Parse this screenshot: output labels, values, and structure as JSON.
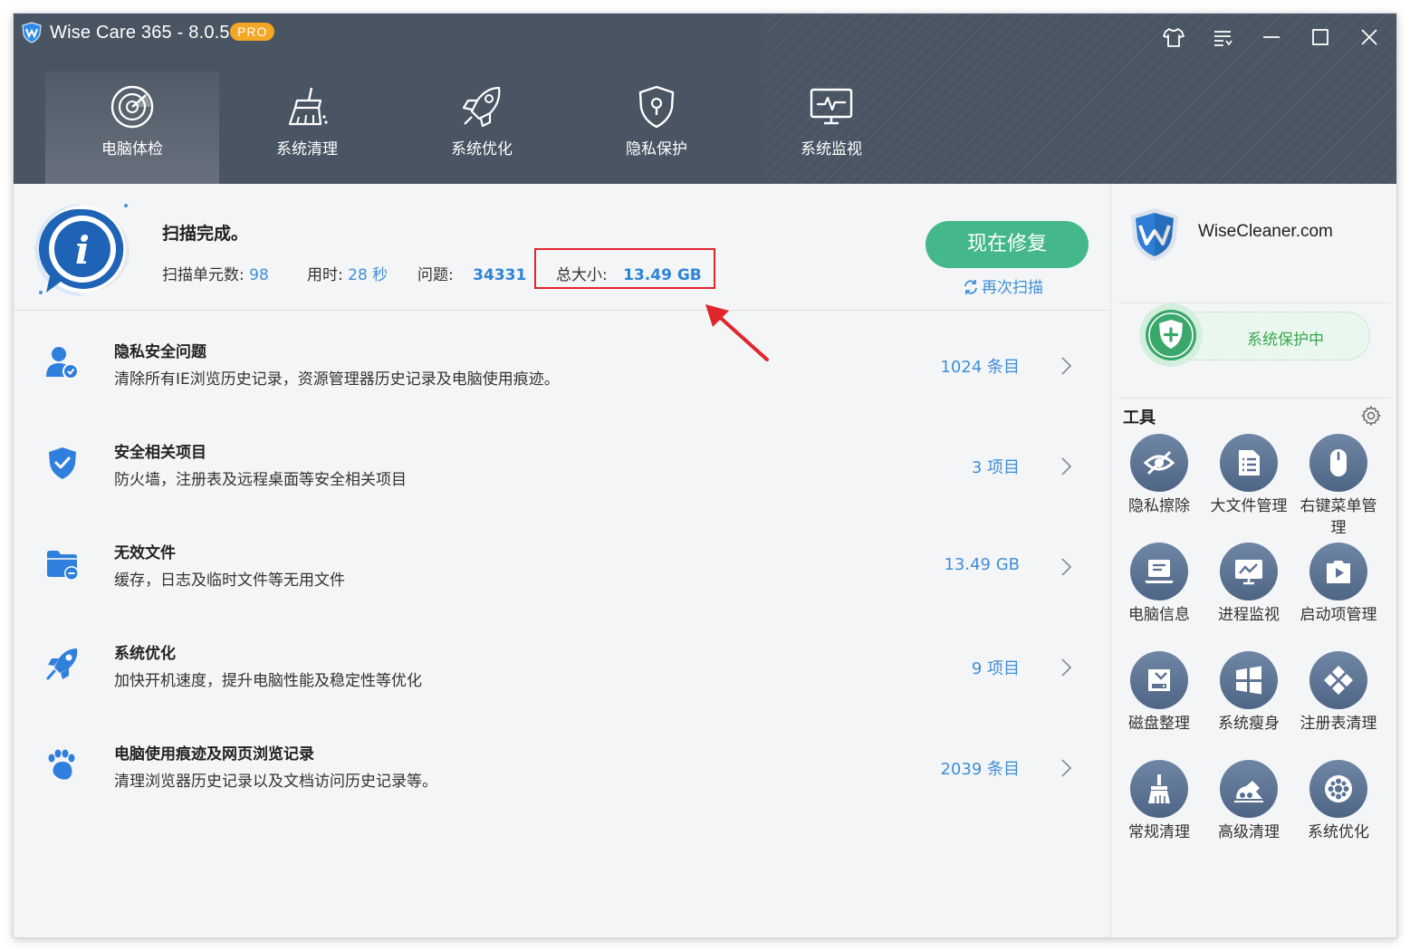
{
  "app": {
    "title": "Wise Care 365 - 8.0.5",
    "badge": "PRO"
  },
  "nav": {
    "tabs": [
      {
        "label": "电脑体检",
        "icon": "radar-icon",
        "active": true
      },
      {
        "label": "系统清理",
        "icon": "broom-icon",
        "active": false
      },
      {
        "label": "系统优化",
        "icon": "rocket-icon",
        "active": false
      },
      {
        "label": "隐私保护",
        "icon": "shield-lock-icon",
        "active": false
      },
      {
        "label": "系统监视",
        "icon": "monitor-pulse-icon",
        "active": false
      }
    ]
  },
  "summary": {
    "title": "扫描完成。",
    "units_label": "扫描单元数:",
    "units_value": "98",
    "time_label": "用时:",
    "time_value": "28 秒",
    "issues_label": "问题:",
    "issues_value": "34331",
    "size_label": "总大小:",
    "size_value": "13.49 GB",
    "fix_button": "现在修复",
    "rescan": "再次扫描"
  },
  "issues": [
    {
      "title": "隐私安全问题",
      "desc": "清除所有IE浏览历史记录，资源管理器历史记录及电脑使用痕迹。",
      "count": "1024 条目",
      "icon": "user-shield-icon"
    },
    {
      "title": "安全相关项目",
      "desc": "防火墙，注册表及远程桌面等安全相关项目",
      "count": "3 项目",
      "icon": "shield-check-icon"
    },
    {
      "title": "无效文件",
      "desc": "缓存，日志及临时文件等无用文件",
      "count": "13.49 GB",
      "icon": "folder-remove-icon"
    },
    {
      "title": "系统优化",
      "desc": "加快开机速度，提升电脑性能及稳定性等优化",
      "count": "9 项目",
      "icon": "rocket-icon"
    },
    {
      "title": "电脑使用痕迹及网页浏览记录",
      "desc": "清理浏览器历史记录以及文档访问历史记录等。",
      "count": "2039 条目",
      "icon": "footprint-icon"
    }
  ],
  "right": {
    "site": "WiseCleaner.com",
    "protect": "系统保护中",
    "tools_title": "工具",
    "tools": [
      {
        "label": "隐私擦除",
        "icon": "eye-off-icon"
      },
      {
        "label": "大文件管理",
        "icon": "file-list-icon"
      },
      {
        "label": "右键菜单管理",
        "icon": "mouse-icon"
      },
      {
        "label": "电脑信息",
        "icon": "laptop-icon"
      },
      {
        "label": "进程监视",
        "icon": "chart-monitor-icon"
      },
      {
        "label": "启动项管理",
        "icon": "startup-icon"
      },
      {
        "label": "磁盘整理",
        "icon": "disk-icon"
      },
      {
        "label": "系统瘦身",
        "icon": "windows-icon"
      },
      {
        "label": "注册表清理",
        "icon": "registry-icon"
      },
      {
        "label": "常规清理",
        "icon": "brush-icon"
      },
      {
        "label": "高级清理",
        "icon": "advanced-clean-icon"
      },
      {
        "label": "系统优化",
        "icon": "gear-optimize-icon"
      }
    ]
  },
  "colors": {
    "header_bg": "#4a5563",
    "accent_blue": "#3f8fd8",
    "fix_green": "#45b88b",
    "protect_green": "#3aa64f",
    "highlight_red": "#e0252b"
  }
}
